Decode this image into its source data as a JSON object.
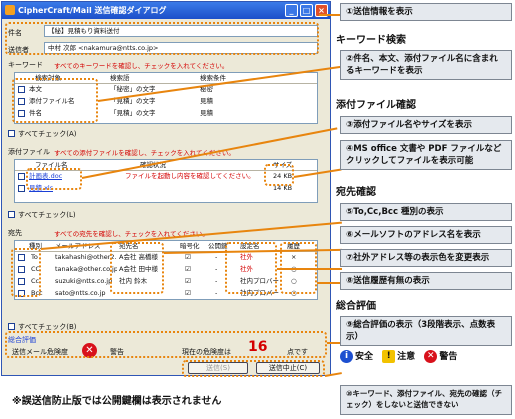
{
  "window": {
    "title": "CipherCraft/Mail 送信確認ダイアログ"
  },
  "subject": {
    "label": "件名",
    "value": "【秘】見積もり資料送付"
  },
  "sender": {
    "label": "送信者",
    "value": "中村 次郎 <nakamura@ntts.co.jp>"
  },
  "keyword": {
    "section": "キーワード",
    "notice": "すべてのキーワードを確認し、チェックを入れてください。",
    "headers": [
      "検索対象",
      "検索語",
      "検索条件"
    ],
    "rows": [
      {
        "target": "本文",
        "word": "「秘密」の文字",
        "cond": "秘密"
      },
      {
        "target": "添付ファイル名",
        "word": "「見積」の文字",
        "cond": "見積"
      },
      {
        "target": "件名",
        "word": "「見積」の文字",
        "cond": "見積"
      }
    ],
    "check_all": "すべてチェック(A)"
  },
  "attach": {
    "section": "添付ファイル",
    "notice": "すべての添付ファイルを確認し、チェックを入れてください。",
    "headers": [
      "ファイル名",
      "確認状況",
      "サイズ"
    ],
    "rows": [
      {
        "name": "計画表.doc",
        "status": "ファイルを起動し内容を確認してください。",
        "size": "24 KB"
      },
      {
        "name": "見積.xls",
        "status": "",
        "size": "14 KB"
      }
    ],
    "check_all": "すべてチェック(L)"
  },
  "dest": {
    "section": "宛先",
    "notice": "すべての宛先を確認し、チェックを入れてください。",
    "headers": [
      "種別",
      "メールアドレス",
      "宛先名",
      "暗号化",
      "公開鍵",
      "設定名",
      "履歴"
    ],
    "rows": [
      {
        "type": "To",
        "addr": "takahashi@other2.c...",
        "name": "A会社 高橋様",
        "enc": "☑",
        "key": "-",
        "setting": "社外",
        "hist": "×"
      },
      {
        "type": "CC",
        "addr": "tanaka@other.co.jp",
        "name": "A会社 田中様",
        "enc": "☑",
        "key": "-",
        "setting": "社外",
        "hist": "○"
      },
      {
        "type": "Cc",
        "addr": "suzuki@ntts.co.jp",
        "name": "社内 鈴木",
        "enc": "☑",
        "key": "-",
        "setting": "社内プロバー",
        "hist": "○"
      },
      {
        "type": "Bcc",
        "addr": "sato@ntts.co.jp",
        "name": "",
        "enc": "☑",
        "key": "-",
        "setting": "社内プロバー",
        "hist": "○"
      }
    ],
    "check_all": "すべてチェック(B)"
  },
  "evaluation": {
    "section": "総合評価",
    "risk_label": "送信メール危険度",
    "level": "警告",
    "current_label": "現在の危険度は",
    "score": "16",
    "unit": "点です"
  },
  "buttons": {
    "send": "送信(S)",
    "cancel": "送信中止(C)"
  },
  "panel": {
    "p1": "①送信情報を表示",
    "h_keyword": "キーワード検索",
    "p2": "②件名、本文、添付ファイル名に含まれるキーワードを表示",
    "h_attach": "添付ファイル確認",
    "p3": "③添付ファイル名やサイズを表示",
    "p4": "④MS office 文書や PDF ファイルなどクリックしてファイルを表示可能",
    "h_dest": "宛先確認",
    "p5": "⑤To,Cc,Bcc 種別の表示",
    "p6": "⑥メールソフトのアドレス名を表示",
    "p7": "⑦社外アドレス等の表示色を変更表示",
    "p8": "⑧送信履歴有無の表示",
    "h_eval": "総合評価",
    "p9": "⑨総合評価の表示（3段階表示、点数表示）",
    "e_safe": "安全",
    "e_caution": "注意",
    "e_warn": "警告",
    "p10": "⑩キーワード、添付ファイル、宛先の確認（チェック）をしないと送信できない"
  },
  "footnote": "※誤送信防止版では公開鍵欄は表示されません"
}
